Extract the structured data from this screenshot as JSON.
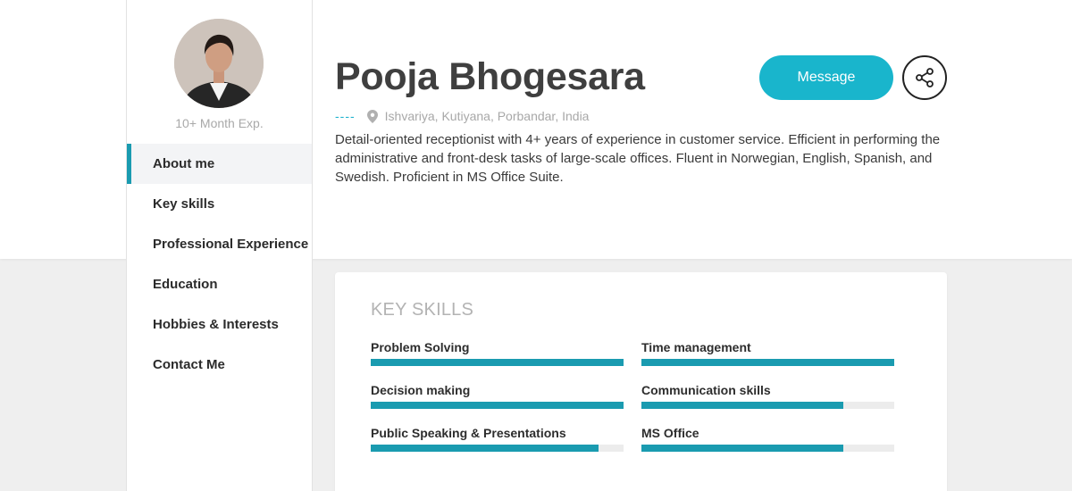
{
  "profile": {
    "name": "Pooja Bhogesara",
    "experience": "10+ Month Exp.",
    "location_prefix": "----",
    "location": "Ishvariya, Kutiyana, Porbandar, India",
    "about": "Detail-oriented receptionist with 4+ years of experience in customer service. Efficient in performing the administrative and front-desk tasks of large-scale offices. Fluent in Norwegian, English, Spanish, and Swedish. Proficient in MS Office Suite."
  },
  "actions": {
    "message_label": "Message",
    "share_icon": "share-icon"
  },
  "sidebar": {
    "items": [
      {
        "label": "About me",
        "active": true
      },
      {
        "label": "Key skills",
        "active": false
      },
      {
        "label": "Professional Experience",
        "active": false
      },
      {
        "label": "Education",
        "active": false
      },
      {
        "label": "Hobbies & Interests",
        "active": false
      },
      {
        "label": "Contact Me",
        "active": false
      }
    ]
  },
  "key_skills": {
    "title": "KEY SKILLS",
    "skills": [
      {
        "label": "Problem Solving",
        "level": 1.0
      },
      {
        "label": "Time management",
        "level": 1.0
      },
      {
        "label": "Decision making",
        "level": 1.0
      },
      {
        "label": "Communication skills",
        "level": 0.8
      },
      {
        "label": "Public Speaking & Presentations",
        "level": 0.9
      },
      {
        "label": "MS Office",
        "level": 0.8
      }
    ]
  },
  "colors": {
    "accent": "#1a9bb0",
    "button": "#19b5cc",
    "page_bg": "#efefef"
  }
}
